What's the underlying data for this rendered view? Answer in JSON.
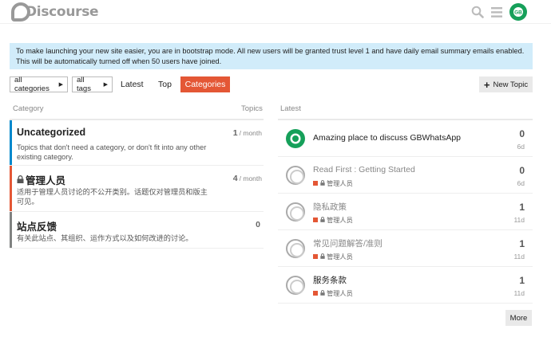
{
  "header": {
    "logo_text": "Discourse",
    "search_icon": "search-icon",
    "menu_icon": "hamburger-icon",
    "user_avatar_text": "GB"
  },
  "banner": {
    "line1": "To make launching your new site easier, you are in bootstrap mode. All new users will be granted trust level 1 and have daily email summary emails enabled.",
    "line2": "This will be automatically turned off when 50 users have joined."
  },
  "nav": {
    "categories_dropdown": "all categories",
    "tags_dropdown": "all tags",
    "latest": "Latest",
    "top": "Top",
    "categories": "Categories",
    "new_topic": "New Topic"
  },
  "categories_column": {
    "header_category": "Category",
    "header_topics": "Topics",
    "items": [
      {
        "name": "Uncategorized",
        "description": "Topics that don't need a category, or don't fit into any other existing category.",
        "count": "1",
        "period": "/ month",
        "color": "#0088cc",
        "locked": false
      },
      {
        "name": "管理人员",
        "description": "适用于管理人员讨论的不公开类别。话题仅对管理员和版主可见。",
        "count": "4",
        "period": "/ month",
        "color": "#e45735",
        "locked": true
      },
      {
        "name": "站点反馈",
        "description": "有关此站点、其组织、运作方式以及如何改进的讨论。",
        "count": "0",
        "period": "",
        "color": "#808281",
        "locked": false
      }
    ]
  },
  "latest_column": {
    "header": "Latest",
    "topics": [
      {
        "title": "Amazing place to discuss GBWhatsApp",
        "category": "",
        "replies": "0",
        "age": "6d",
        "read": false,
        "avatar": "gbwhatsapp-avatar"
      },
      {
        "title": "Read First : Getting Started",
        "category": "管理人员",
        "replies": "0",
        "age": "6d",
        "read": true,
        "avatar": "discourse-avatar"
      },
      {
        "title": "隐私政策",
        "category": "管理人员",
        "replies": "1",
        "age": "11d",
        "read": true,
        "avatar": "discourse-avatar"
      },
      {
        "title": "常见问题解答/准则",
        "category": "管理人员",
        "replies": "1",
        "age": "11d",
        "read": true,
        "avatar": "discourse-avatar"
      },
      {
        "title": "服务条款",
        "category": "管理人员",
        "replies": "1",
        "age": "11d",
        "read": false,
        "avatar": "discourse-avatar"
      }
    ],
    "more_button": "More"
  },
  "colors": {
    "accent": "#e45735",
    "banner_bg": "#d1ecfa",
    "uncategorized": "#0088cc",
    "staff": "#e45735",
    "feedback": "#808281"
  }
}
